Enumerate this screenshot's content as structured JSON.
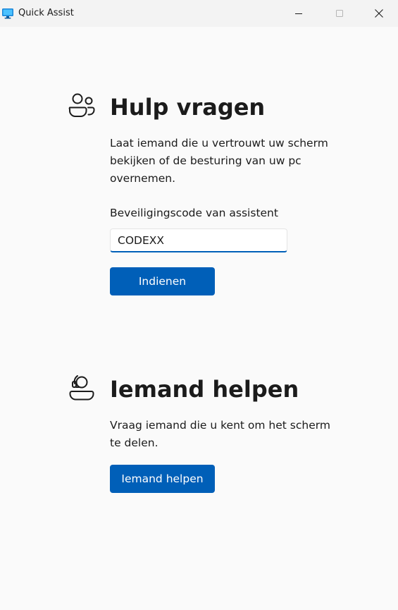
{
  "window": {
    "title": "Quick Assist",
    "icon": "quick-assist-monitor-icon",
    "controls": {
      "minimize_icon": "minimize-icon",
      "maximize_icon": "maximize-icon",
      "close_icon": "close-icon"
    }
  },
  "get_help": {
    "icon": "people-icon",
    "heading": "Hulp vragen",
    "description_lines": [
      "Laat iemand die u vertrouwt uw scherm",
      "bekijken of de besturing van uw pc",
      "overnemen."
    ],
    "code_label": "Beveiligingscode van assistent",
    "code_value": "CODEXX",
    "submit_label": "Indienen"
  },
  "give_help": {
    "icon": "person-headset-icon",
    "heading": "Iemand helpen",
    "description_lines": [
      "Vraag iemand die u kent om het scherm",
      "te delen."
    ],
    "button_label": "Iemand helpen"
  },
  "colors": {
    "accent": "#005fb8",
    "background": "#fafafa",
    "titlebar": "#f3f3f3",
    "text": "#1b1b1b"
  }
}
